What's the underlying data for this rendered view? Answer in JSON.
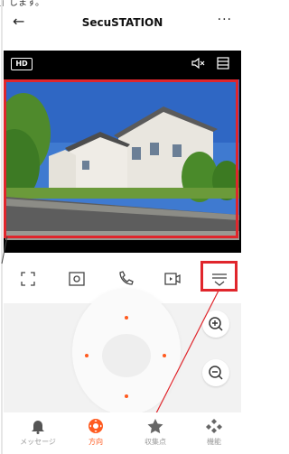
{
  "caption": "」します。",
  "header": {
    "back_icon": "back-arrow-icon",
    "title": "SecuSTATION",
    "more_icon": "more-icon"
  },
  "video": {
    "quality_label": "HD",
    "mute_icon": "mute-icon",
    "fullscreen_icon": "fullscreen-icon"
  },
  "toolbar": {
    "items": [
      {
        "icon": "expand-icon"
      },
      {
        "icon": "snapshot-icon"
      },
      {
        "icon": "call-icon"
      },
      {
        "icon": "record-icon"
      },
      {
        "icon": "collapse-icon"
      }
    ]
  },
  "ptz": {
    "zoom_in_icon": "zoom-in-icon",
    "zoom_out_icon": "zoom-out-icon"
  },
  "nav": {
    "items": [
      {
        "label": "メッセージ",
        "icon": "bell-icon",
        "active": false
      },
      {
        "label": "方向",
        "icon": "direction-icon",
        "active": true
      },
      {
        "label": "収集点",
        "icon": "star-icon",
        "active": false
      },
      {
        "label": "機能",
        "icon": "function-icon",
        "active": false
      }
    ]
  },
  "colors": {
    "accent": "#ff5a1f",
    "highlight_box": "#e0262c"
  }
}
